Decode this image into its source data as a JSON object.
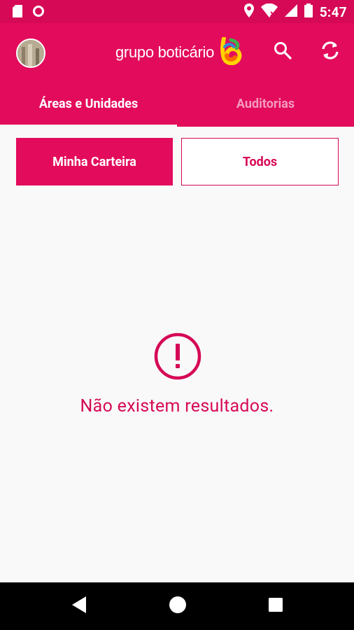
{
  "status_bar": {
    "time": "5:47",
    "icons": [
      "sd-card-icon",
      "notification-circle-icon",
      "location-pin-icon",
      "wifi-icon",
      "cell-signal-icon",
      "battery-icon"
    ]
  },
  "app_bar": {
    "logo_text": "grupo boticário",
    "actions": [
      "search-icon",
      "refresh-icon"
    ]
  },
  "tabs": [
    {
      "label": "Áreas e Unidades",
      "active": true
    },
    {
      "label": "Auditorias",
      "active": false
    }
  ],
  "filters": {
    "mine_label": "Minha Carteira",
    "all_label": "Todos",
    "selected": "Minha Carteira"
  },
  "empty_state": {
    "icon": "alert-circle-icon",
    "message": "Não existem resultados."
  },
  "nav_bar": {
    "buttons": [
      "back-icon",
      "home-icon",
      "recents-icon"
    ]
  },
  "colors": {
    "primary": "#e30b5c",
    "primary_dark": "#d60956",
    "tab_inactive": "#f39bbd",
    "background": "#f9f9f9"
  }
}
